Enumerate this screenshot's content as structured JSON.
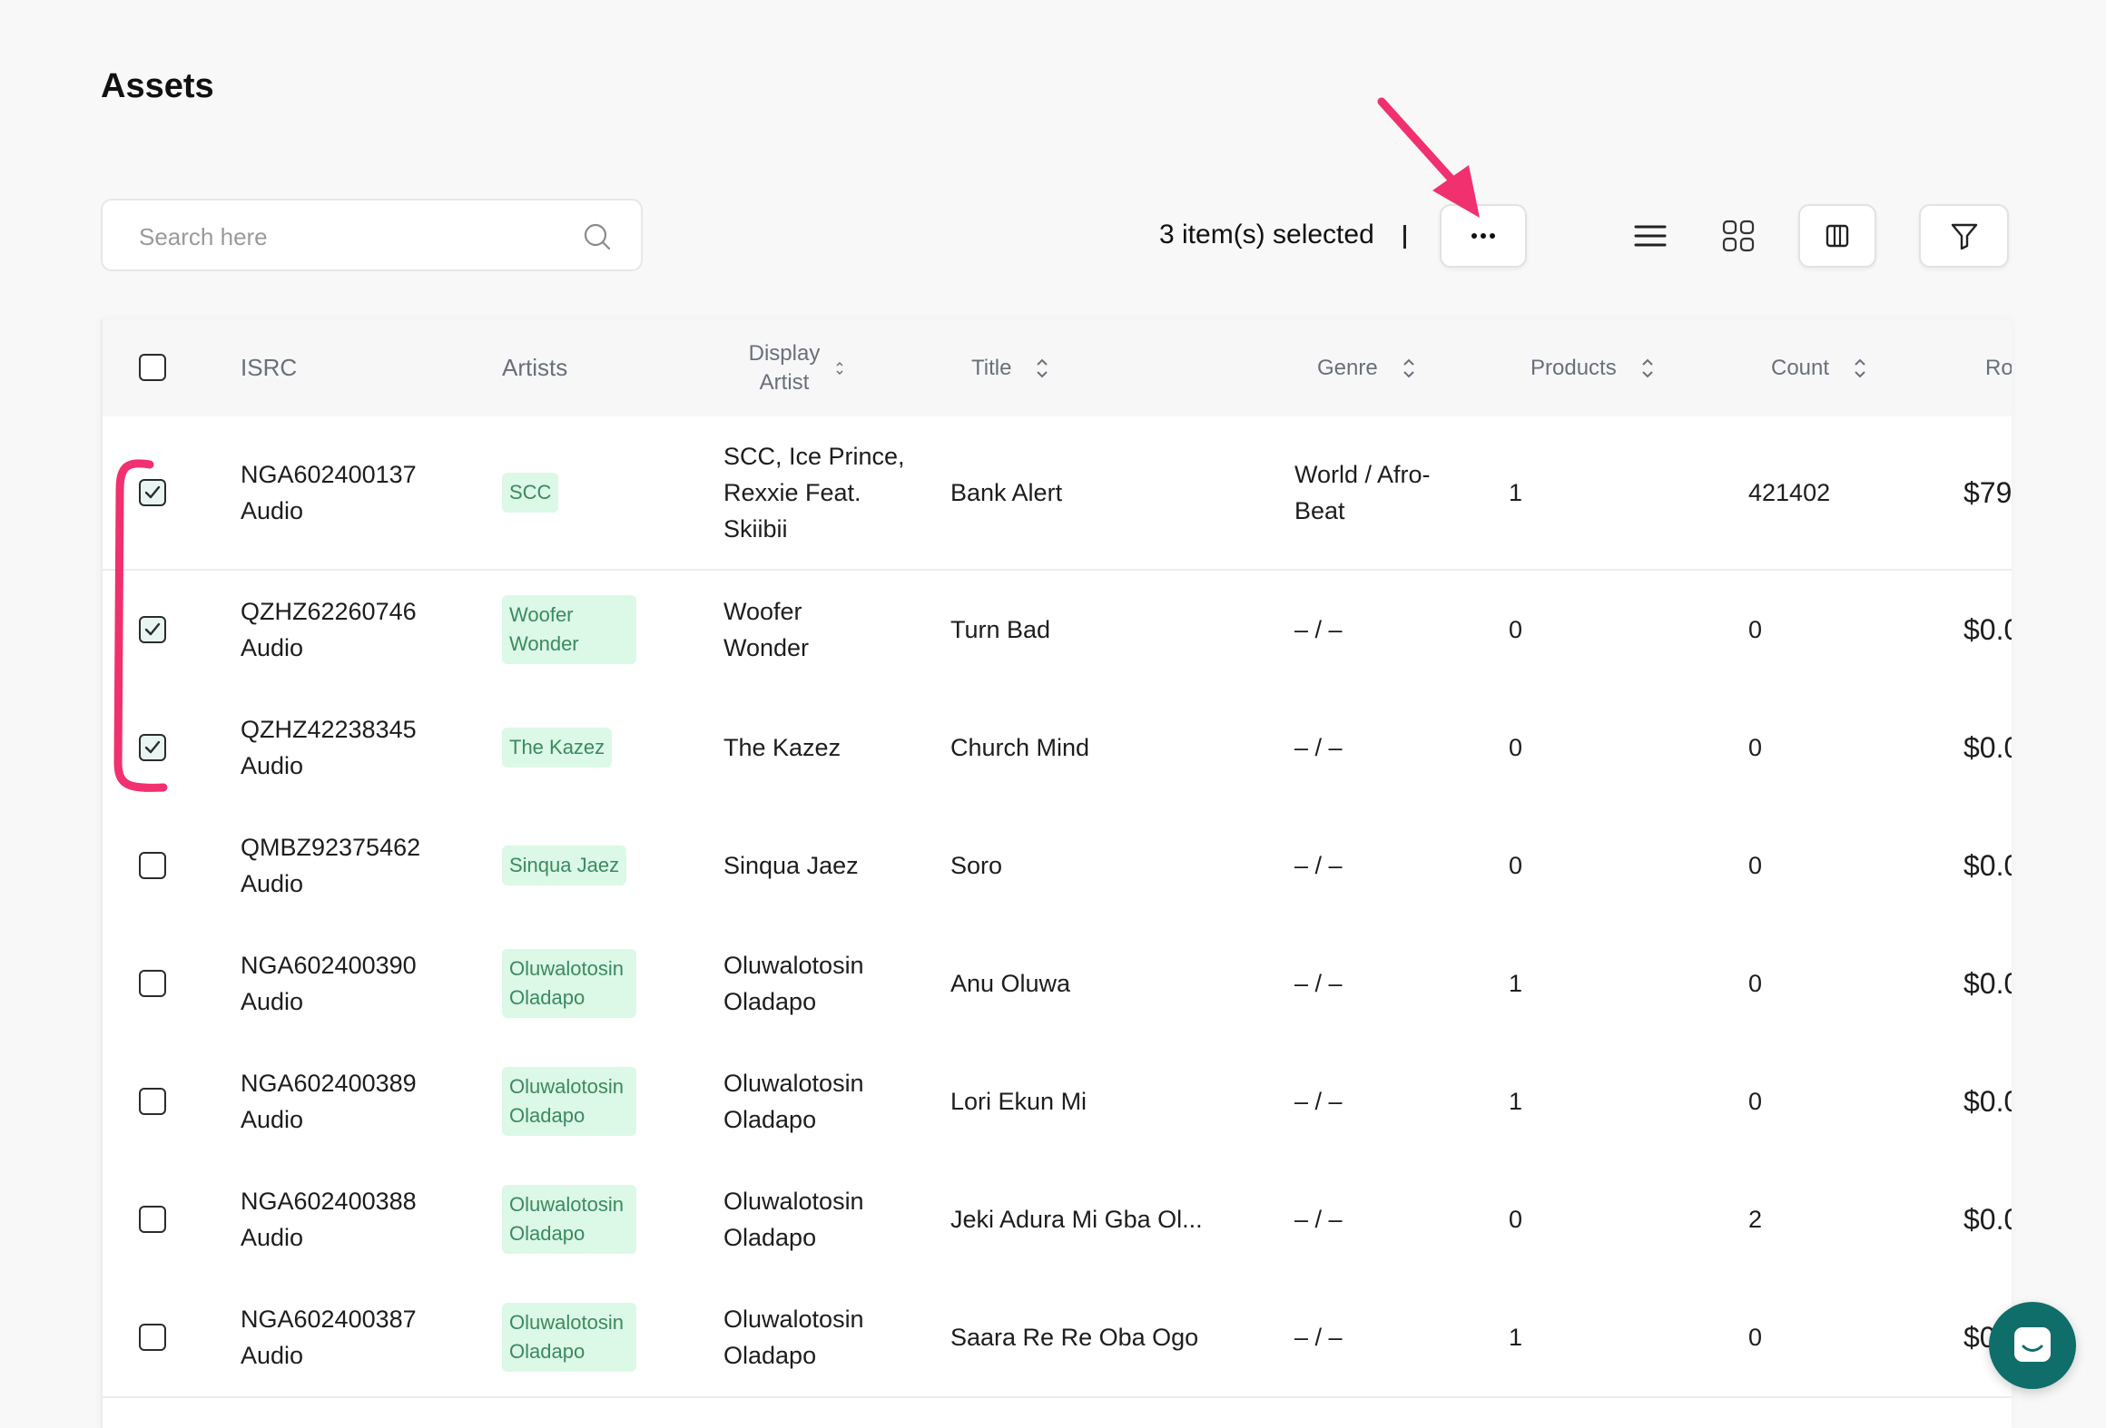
{
  "page": {
    "title": "Assets"
  },
  "search": {
    "placeholder": "Search here"
  },
  "toolbar": {
    "selected_text": "3 item(s) selected",
    "separator": "|",
    "more_label": "···"
  },
  "columns": {
    "isrc": "ISRC",
    "artists": "Artists",
    "display_artist": "Display Artist",
    "title": "Title",
    "genre": "Genre",
    "products": "Products",
    "count": "Count",
    "ro": "Ro"
  },
  "rows": [
    {
      "checked": true,
      "isrc": "NGA602400137",
      "type": "Audio",
      "artist": "SCC",
      "display_artist": "SCC, Ice Prince, Rexxie Feat. Skiibii",
      "title": "Bank Alert",
      "genre": "World / Afro-Beat",
      "products": "1",
      "count": "421402",
      "ro": "$79"
    },
    {
      "checked": true,
      "isrc": "QZHZ62260746",
      "type": "Audio",
      "artist": "Woofer Wonder",
      "display_artist": "Woofer Wonder",
      "title": "Turn Bad",
      "genre": "– / –",
      "products": "0",
      "count": "0",
      "ro": "$0.0"
    },
    {
      "checked": true,
      "isrc": "QZHZ42238345",
      "type": "Audio",
      "artist": "The Kazez",
      "display_artist": "The Kazez",
      "title": "Church Mind",
      "genre": "– / –",
      "products": "0",
      "count": "0",
      "ro": "$0.0"
    },
    {
      "checked": false,
      "isrc": "QMBZ92375462",
      "type": "Audio",
      "artist": "Sinqua Jaez",
      "display_artist": "Sinqua Jaez",
      "title": "Soro",
      "genre": "– / –",
      "products": "0",
      "count": "0",
      "ro": "$0.0"
    },
    {
      "checked": false,
      "isrc": "NGA602400390",
      "type": "Audio",
      "artist": "Oluwalotosin Oladapo",
      "display_artist": "Oluwalotosin Oladapo",
      "title": "Anu Oluwa",
      "genre": "– / –",
      "products": "1",
      "count": "0",
      "ro": "$0.0"
    },
    {
      "checked": false,
      "isrc": "NGA602400389",
      "type": "Audio",
      "artist": "Oluwalotosin Oladapo",
      "display_artist": "Oluwalotosin Oladapo",
      "title": "Lori Ekun Mi",
      "genre": "– / –",
      "products": "1",
      "count": "0",
      "ro": "$0.0"
    },
    {
      "checked": false,
      "isrc": "NGA602400388",
      "type": "Audio",
      "artist": "Oluwalotosin Oladapo",
      "display_artist": "Oluwalotosin Oladapo",
      "title": "Jeki Adura Mi Gba Ol...",
      "genre": "– / –",
      "products": "0",
      "count": "2",
      "ro": "$0.0"
    },
    {
      "checked": false,
      "isrc": "NGA602400387",
      "type": "Audio",
      "artist": "Oluwalotosin Oladapo",
      "display_artist": "Oluwalotosin Oladapo",
      "title": "Saara Re Re Oba Ogo",
      "genre": "– / –",
      "products": "1",
      "count": "0",
      "ro": "$0"
    }
  ],
  "colors": {
    "accent": "#0f6e6a",
    "tag_bg": "#dcf8e6",
    "tag_text": "#3b8a5f",
    "annotation": "#f0306f"
  },
  "icons": [
    "search-icon",
    "more-horizontal-icon",
    "list-view-icon",
    "grid-view-icon",
    "columns-icon",
    "filter-icon",
    "sort-icon",
    "check-icon",
    "chat-icon"
  ]
}
